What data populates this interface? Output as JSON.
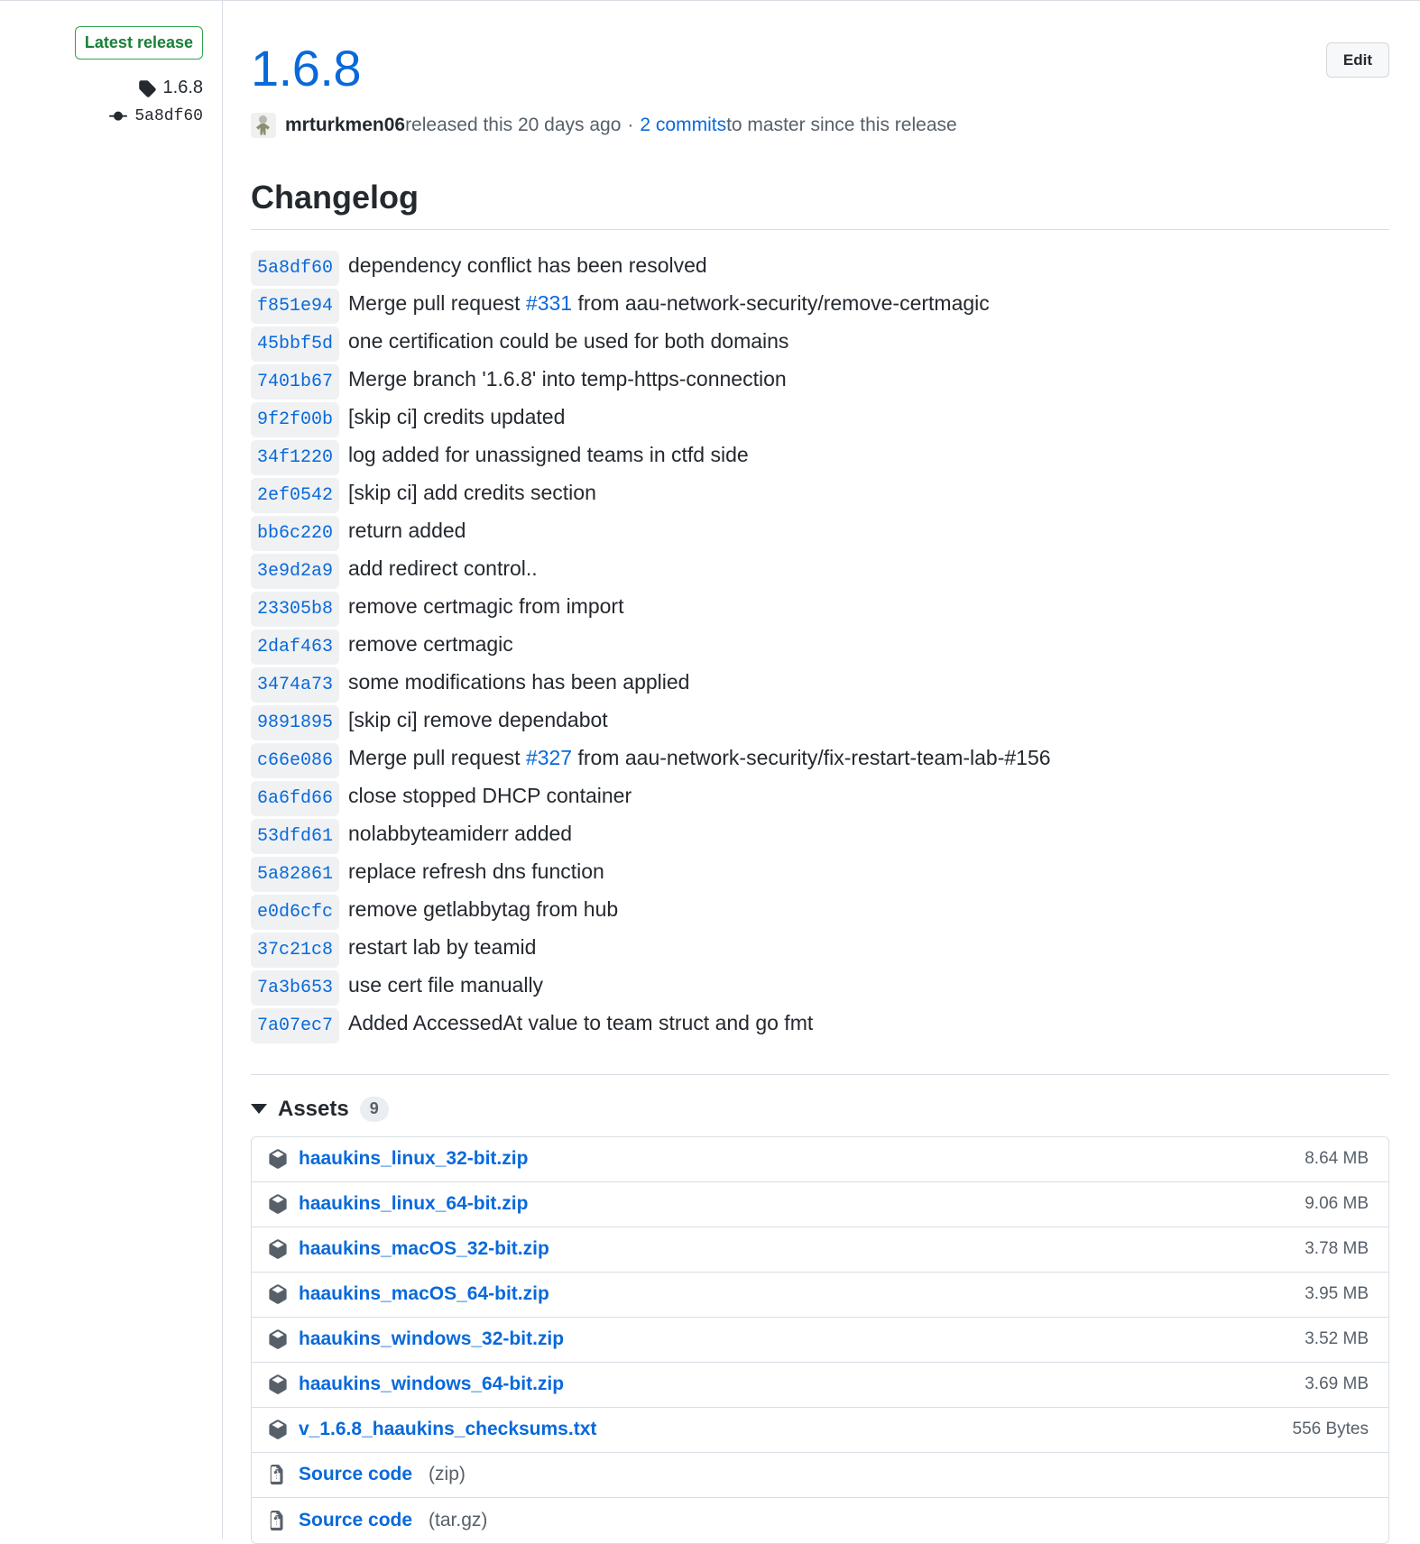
{
  "sidebar": {
    "latest_badge": "Latest release",
    "tag_icon": "tag-icon",
    "tag": "1.6.8",
    "commit_icon": "git-commit-icon",
    "commit_sha": "5a8df60"
  },
  "header": {
    "edit_label": "Edit",
    "title": "1.6.8",
    "avatar_icon": "avatar",
    "author": "mrturkmen06",
    "released_text": " released this 20 days ago",
    "separator": "·",
    "commits_link": "2 commits",
    "commits_suffix": " to master since this release"
  },
  "changelog": {
    "heading": "Changelog",
    "commits": [
      {
        "sha": "5a8df60",
        "message": "dependency conflict has been resolved"
      },
      {
        "sha": "f851e94",
        "message_before": "Merge pull request ",
        "pr": "#331",
        "message_after": " from aau-network-security/remove-certmagic"
      },
      {
        "sha": "45bbf5d",
        "message": "one certification could be used for both domains"
      },
      {
        "sha": "7401b67",
        "message": "Merge branch '1.6.8' into temp-https-connection"
      },
      {
        "sha": "9f2f00b",
        "message": "[skip ci] credits updated"
      },
      {
        "sha": "34f1220",
        "message": "log added for unassigned teams in ctfd side"
      },
      {
        "sha": "2ef0542",
        "message": "[skip ci] add credits section"
      },
      {
        "sha": "bb6c220",
        "message": "return added"
      },
      {
        "sha": "3e9d2a9",
        "message": "add redirect control.."
      },
      {
        "sha": "23305b8",
        "message": "remove certmagic from import"
      },
      {
        "sha": "2daf463",
        "message": "remove certmagic"
      },
      {
        "sha": "3474a73",
        "message": "some modifications has been applied"
      },
      {
        "sha": "9891895",
        "message": "[skip ci] remove dependabot"
      },
      {
        "sha": "c66e086",
        "message_before": "Merge pull request ",
        "pr": "#327",
        "message_after": " from aau-network-security/fix-restart-team-lab-#156"
      },
      {
        "sha": "6a6fd66",
        "message": "close stopped DHCP container"
      },
      {
        "sha": "53dfd61",
        "message": "nolabbyteamiderr added"
      },
      {
        "sha": "5a82861",
        "message": "replace refresh dns function"
      },
      {
        "sha": "e0d6cfc",
        "message": "remove getlabbytag from hub"
      },
      {
        "sha": "37c21c8",
        "message": "restart lab by teamid"
      },
      {
        "sha": "7a3b653",
        "message": "use cert file manually"
      },
      {
        "sha": "7a07ec7",
        "message": "Added AccessedAt value to team struct and go fmt"
      }
    ]
  },
  "assets": {
    "label": "Assets",
    "count": "9",
    "caret_icon": "caret-down-icon",
    "rows": [
      {
        "icon": "package-icon",
        "name": "haaukins_linux_32-bit.zip",
        "sub": "",
        "size": "8.64 MB"
      },
      {
        "icon": "package-icon",
        "name": "haaukins_linux_64-bit.zip",
        "sub": "",
        "size": "9.06 MB"
      },
      {
        "icon": "package-icon",
        "name": "haaukins_macOS_32-bit.zip",
        "sub": "",
        "size": "3.78 MB"
      },
      {
        "icon": "package-icon",
        "name": "haaukins_macOS_64-bit.zip",
        "sub": "",
        "size": "3.95 MB"
      },
      {
        "icon": "package-icon",
        "name": "haaukins_windows_32-bit.zip",
        "sub": "",
        "size": "3.52 MB"
      },
      {
        "icon": "package-icon",
        "name": "haaukins_windows_64-bit.zip",
        "sub": "",
        "size": "3.69 MB"
      },
      {
        "icon": "package-icon",
        "name": "v_1.6.8_haaukins_checksums.txt",
        "sub": "",
        "size": "556 Bytes"
      },
      {
        "icon": "file-zip-icon",
        "name": "Source code",
        "sub": "(zip)",
        "size": ""
      },
      {
        "icon": "file-zip-icon",
        "name": "Source code",
        "sub": "(tar.gz)",
        "size": ""
      }
    ]
  },
  "colors": {
    "link": "#0969da",
    "green": "#2da44e",
    "muted": "#57606a",
    "border": "#d8dee4"
  }
}
